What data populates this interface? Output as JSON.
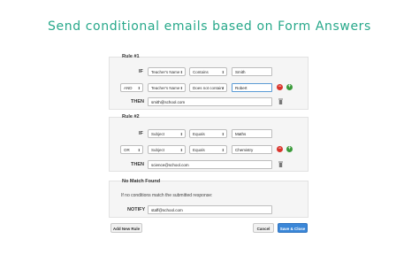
{
  "headline": "Send conditional emails based on Form Answers",
  "rule1": {
    "title": "Rule #1",
    "if_label": "IF",
    "conds": [
      {
        "field": "Teacher's Name",
        "op": "Contains",
        "value": "Smith"
      },
      {
        "join": "AND",
        "field": "Teacher's Name",
        "op": "Does not contain",
        "value": "Robert"
      }
    ],
    "then_label": "THEN",
    "email": "smith@school.com"
  },
  "rule2": {
    "title": "Rule #2",
    "if_label": "IF",
    "conds": [
      {
        "field": "Subject",
        "op": "Equals",
        "value": "Maths"
      },
      {
        "join": "OR",
        "field": "Subject",
        "op": "Equals",
        "value": "Chemistry"
      }
    ],
    "then_label": "THEN",
    "email": "science@school.com"
  },
  "nomatch": {
    "title": "No Match Found",
    "note": "If no conditions match the submitted response:",
    "notify_label": "NOTIFY",
    "email": "staff@school.com"
  },
  "buttons": {
    "add_rule": "Add New Rule",
    "cancel": "Cancel",
    "save": "Save & Close"
  },
  "icons": {
    "remove": "remove-circle-icon",
    "add": "add-circle-icon",
    "delete": "trash-icon",
    "dropdown": "dropdown-arrow-icon"
  },
  "colors": {
    "headline": "#27a88a",
    "primary": "#3b87d8",
    "remove": "#d9342b",
    "add": "#3a9a3a"
  }
}
